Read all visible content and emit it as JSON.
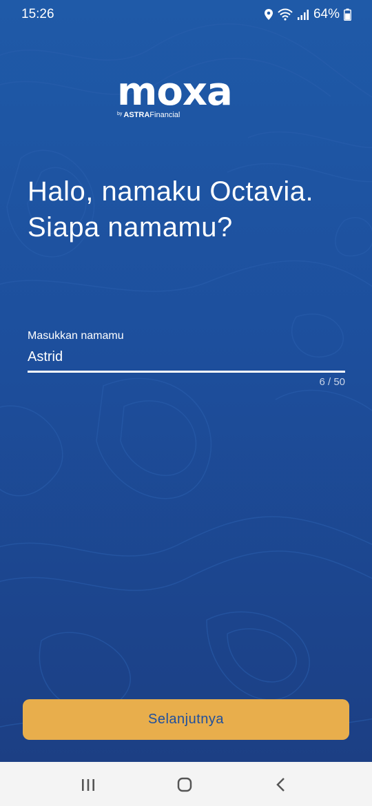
{
  "status_bar": {
    "time": "15:26",
    "battery": "64%",
    "icons": [
      "location-icon",
      "wifi-icon",
      "signal-icon",
      "battery-icon"
    ]
  },
  "logo": {
    "wordmark": "moxa",
    "byline_prefix": "by",
    "byline_brand": "ASTRA",
    "byline_suffix": "Financial"
  },
  "greeting": {
    "text": "Halo, namaku Octavia. Siapa namamu?"
  },
  "name_field": {
    "label": "Masukkan namamu",
    "value": "Astrid",
    "counter": "6 / 50"
  },
  "next_button": {
    "label": "Selanjutnya"
  },
  "nav_bar": {
    "icons": [
      "recents-icon",
      "home-icon",
      "back-icon"
    ]
  },
  "colors": {
    "background_top": "#1f5aa8",
    "background_bottom": "#1c3f84",
    "button": "#e8ae4c",
    "button_text": "#1e4f9d"
  }
}
